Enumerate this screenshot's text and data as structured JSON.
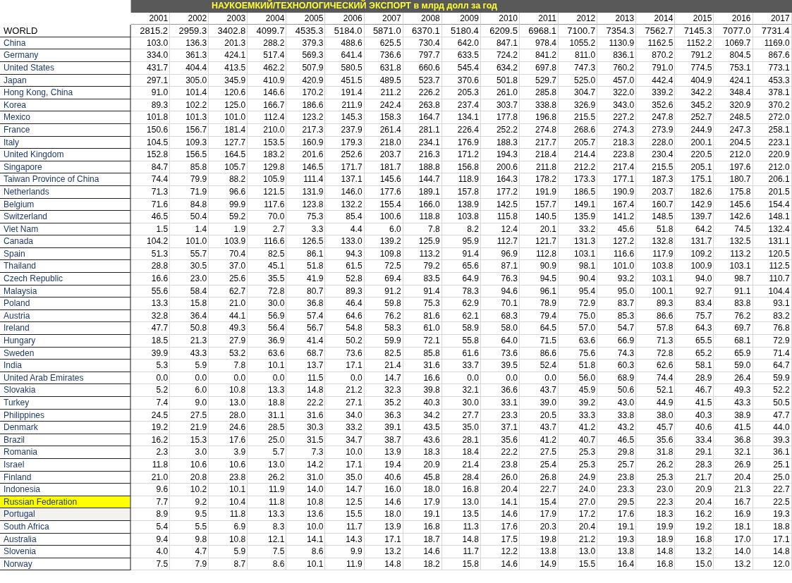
{
  "title": "НАУКОЕМКИЙ/ТЕХНОЛОГИЧЕСКИЙ ЭКСПОРТ в млрд долл за год",
  "years": [
    "2001",
    "2002",
    "2003",
    "2004",
    "2005",
    "2006",
    "2007",
    "2008",
    "2009",
    "2010",
    "2011",
    "2012",
    "2013",
    "2014",
    "2015",
    "2016",
    "2017"
  ],
  "rows": [
    {
      "name": "WORLD",
      "kind": "total",
      "highlighted": false,
      "selected": false,
      "values": [
        "2815.2",
        "2959.3",
        "3402.8",
        "4099.7",
        "4535.3",
        "5184.0",
        "5871.0",
        "6370.1",
        "5180.4",
        "6209.5",
        "6968.1",
        "7100.7",
        "7354.3",
        "7562.7",
        "7145.3",
        "7077.0",
        "7731.4"
      ]
    },
    {
      "name": "China",
      "kind": "country",
      "highlighted": false,
      "selected": false,
      "values": [
        "103.0",
        "136.3",
        "201.3",
        "288.2",
        "379.3",
        "488.6",
        "625.5",
        "730.4",
        "642.0",
        "847.1",
        "978.4",
        "1055.2",
        "1130.9",
        "1162.5",
        "1152.2",
        "1069.7",
        "1169.0"
      ]
    },
    {
      "name": "Germany",
      "kind": "country",
      "highlighted": false,
      "selected": false,
      "values": [
        "334.0",
        "361.3",
        "424.1",
        "517.4",
        "569.3",
        "641.4",
        "736.6",
        "797.7",
        "633.5",
        "724.2",
        "841.2",
        "811.0",
        "836.1",
        "870.2",
        "791.2",
        "804.5",
        "867.6"
      ]
    },
    {
      "name": "United States",
      "kind": "country",
      "highlighted": false,
      "selected": false,
      "values": [
        "431.7",
        "404.4",
        "413.5",
        "462.2",
        "507.9",
        "580.5",
        "631.8",
        "660.6",
        "545.4",
        "634.2",
        "697.8",
        "747.3",
        "760.2",
        "791.0",
        "774.5",
        "753.1",
        "773.1"
      ]
    },
    {
      "name": "Japan",
      "kind": "country",
      "highlighted": false,
      "selected": false,
      "values": [
        "297.1",
        "305.0",
        "345.9",
        "410.9",
        "420.9",
        "451.5",
        "489.5",
        "523.7",
        "370.6",
        "501.8",
        "529.7",
        "525.0",
        "457.0",
        "442.4",
        "404.9",
        "424.1",
        "453.3"
      ]
    },
    {
      "name": "Hong Kong, China",
      "kind": "country",
      "highlighted": false,
      "selected": false,
      "values": [
        "91.0",
        "101.4",
        "120.6",
        "146.6",
        "170.2",
        "191.4",
        "211.2",
        "226.2",
        "205.3",
        "261.0",
        "285.8",
        "304.7",
        "322.0",
        "339.2",
        "342.2",
        "348.4",
        "378.1"
      ]
    },
    {
      "name": "Korea",
      "kind": "country",
      "highlighted": false,
      "selected": false,
      "values": [
        "89.3",
        "102.2",
        "125.0",
        "166.7",
        "186.6",
        "211.9",
        "242.4",
        "263.8",
        "237.4",
        "303.7",
        "338.8",
        "326.9",
        "343.0",
        "352.6",
        "345.2",
        "320.9",
        "370.2"
      ]
    },
    {
      "name": "Mexico",
      "kind": "country",
      "highlighted": false,
      "selected": false,
      "values": [
        "101.8",
        "101.3",
        "101.0",
        "112.4",
        "123.2",
        "145.3",
        "158.3",
        "164.7",
        "134.1",
        "177.8",
        "196.8",
        "215.5",
        "227.2",
        "247.8",
        "252.7",
        "248.5",
        "272.0"
      ]
    },
    {
      "name": "France",
      "kind": "country",
      "highlighted": false,
      "selected": false,
      "values": [
        "150.6",
        "156.7",
        "181.4",
        "210.0",
        "217.3",
        "237.9",
        "261.4",
        "281.1",
        "226.4",
        "252.2",
        "274.8",
        "268.6",
        "274.3",
        "273.9",
        "244.9",
        "247.3",
        "258.1"
      ]
    },
    {
      "name": "Italy",
      "kind": "country",
      "highlighted": false,
      "selected": false,
      "values": [
        "104.5",
        "109.3",
        "127.7",
        "153.5",
        "160.9",
        "179.3",
        "218.0",
        "234.1",
        "176.9",
        "188.3",
        "217.7",
        "205.7",
        "218.3",
        "228.0",
        "200.1",
        "204.5",
        "223.1"
      ]
    },
    {
      "name": "United Kingdom",
      "kind": "country",
      "highlighted": false,
      "selected": false,
      "values": [
        "152.8",
        "156.5",
        "164.5",
        "183.2",
        "201.6",
        "252.6",
        "203.7",
        "216.3",
        "171.2",
        "194.3",
        "218.4",
        "214.4",
        "223.8",
        "230.4",
        "220.5",
        "212.0",
        "220.9"
      ]
    },
    {
      "name": "Singapore",
      "kind": "country",
      "highlighted": false,
      "selected": false,
      "values": [
        "84.7",
        "85.8",
        "105.7",
        "129.8",
        "146.5",
        "171.7",
        "181.7",
        "188.8",
        "156.8",
        "200.6",
        "211.8",
        "212.2",
        "217.4",
        "215.5",
        "205.1",
        "197.6",
        "212.0"
      ]
    },
    {
      "name": "Taiwan Province of China",
      "kind": "country",
      "highlighted": false,
      "selected": false,
      "values": [
        "74.4",
        "79.9",
        "88.2",
        "105.9",
        "111.4",
        "137.1",
        "145.6",
        "144.7",
        "118.9",
        "164.3",
        "178.2",
        "173.3",
        "177.1",
        "187.3",
        "175.1",
        "180.7",
        "206.1"
      ]
    },
    {
      "name": "Netherlands",
      "kind": "country",
      "highlighted": false,
      "selected": false,
      "values": [
        "71.3",
        "71.9",
        "96.6",
        "121.5",
        "131.9",
        "146.0",
        "177.6",
        "189.1",
        "157.8",
        "177.2",
        "191.9",
        "186.5",
        "190.9",
        "203.7",
        "182.6",
        "175.8",
        "201.5"
      ]
    },
    {
      "name": "Belgium",
      "kind": "country",
      "highlighted": false,
      "selected": false,
      "values": [
        "71.6",
        "84.8",
        "99.9",
        "117.6",
        "123.8",
        "132.2",
        "155.4",
        "166.0",
        "138.9",
        "142.5",
        "157.7",
        "149.1",
        "167.4",
        "160.7",
        "142.9",
        "145.6",
        "154.4"
      ]
    },
    {
      "name": "Switzerland",
      "kind": "country",
      "highlighted": false,
      "selected": false,
      "values": [
        "46.5",
        "50.4",
        "59.2",
        "70.0",
        "75.3",
        "85.4",
        "100.6",
        "118.8",
        "103.8",
        "115.8",
        "140.5",
        "135.9",
        "141.2",
        "148.5",
        "139.7",
        "142.6",
        "148.1"
      ]
    },
    {
      "name": "Viet Nam",
      "kind": "country",
      "highlighted": false,
      "selected": false,
      "values": [
        "1.5",
        "1.4",
        "1.9",
        "2.7",
        "3.3",
        "4.4",
        "6.0",
        "7.8",
        "8.2",
        "12.4",
        "20.1",
        "33.2",
        "45.6",
        "51.8",
        "64.2",
        "74.5",
        "132.4"
      ]
    },
    {
      "name": "Canada",
      "kind": "country",
      "highlighted": false,
      "selected": false,
      "values": [
        "104.2",
        "101.0",
        "103.9",
        "116.6",
        "126.5",
        "133.0",
        "139.2",
        "125.9",
        "95.9",
        "112.7",
        "121.7",
        "131.3",
        "127.2",
        "132.8",
        "131.7",
        "132.5",
        "131.1"
      ]
    },
    {
      "name": "Spain",
      "kind": "country",
      "highlighted": false,
      "selected": false,
      "values": [
        "51.3",
        "55.7",
        "70.4",
        "82.5",
        "86.1",
        "94.3",
        "109.8",
        "113.2",
        "91.4",
        "96.9",
        "112.8",
        "103.1",
        "116.6",
        "117.9",
        "109.2",
        "113.2",
        "120.5"
      ]
    },
    {
      "name": "Thailand",
      "kind": "country",
      "highlighted": false,
      "selected": false,
      "values": [
        "28.8",
        "30.5",
        "37.0",
        "45.1",
        "51.8",
        "61.5",
        "72.5",
        "79.2",
        "65.6",
        "87.1",
        "90.9",
        "98.1",
        "101.0",
        "103.8",
        "100.9",
        "103.1",
        "112.5"
      ]
    },
    {
      "name": "Czech Republic",
      "kind": "country",
      "highlighted": false,
      "selected": false,
      "values": [
        "16.6",
        "23.0",
        "25.6",
        "35.5",
        "41.9",
        "52.8",
        "69.4",
        "83.5",
        "64.9",
        "76.3",
        "94.5",
        "90.4",
        "93.2",
        "103.1",
        "94.0",
        "98.7",
        "110.7"
      ]
    },
    {
      "name": "Malaysia",
      "kind": "country",
      "highlighted": false,
      "selected": false,
      "values": [
        "55.6",
        "58.4",
        "62.7",
        "72.8",
        "80.7",
        "89.3",
        "91.2",
        "91.4",
        "78.3",
        "94.6",
        "96.1",
        "95.4",
        "95.0",
        "100.1",
        "92.7",
        "91.1",
        "104.4"
      ]
    },
    {
      "name": "Poland",
      "kind": "country",
      "highlighted": false,
      "selected": false,
      "values": [
        "13.3",
        "15.8",
        "21.0",
        "30.0",
        "36.8",
        "46.4",
        "59.8",
        "75.3",
        "62.9",
        "70.1",
        "78.9",
        "72.9",
        "83.7",
        "89.3",
        "83.4",
        "83.8",
        "93.1"
      ]
    },
    {
      "name": "Austria",
      "kind": "country",
      "highlighted": false,
      "selected": false,
      "values": [
        "32.8",
        "36.4",
        "44.1",
        "56.9",
        "57.4",
        "64.6",
        "76.2",
        "81.6",
        "62.1",
        "68.3",
        "79.4",
        "75.0",
        "85.3",
        "86.6",
        "75.7",
        "76.2",
        "83.2"
      ]
    },
    {
      "name": "Ireland",
      "kind": "country",
      "highlighted": false,
      "selected": false,
      "values": [
        "47.7",
        "50.8",
        "49.3",
        "56.4",
        "56.7",
        "54.8",
        "58.3",
        "61.0",
        "58.9",
        "58.0",
        "64.5",
        "57.0",
        "54.7",
        "57.8",
        "64.3",
        "69.7",
        "76.8"
      ]
    },
    {
      "name": "Hungary",
      "kind": "country",
      "highlighted": false,
      "selected": false,
      "values": [
        "18.5",
        "21.3",
        "27.9",
        "36.9",
        "41.4",
        "50.2",
        "59.9",
        "72.1",
        "55.8",
        "64.0",
        "71.5",
        "63.6",
        "66.9",
        "71.3",
        "65.5",
        "68.1",
        "72.9"
      ]
    },
    {
      "name": "Sweden",
      "kind": "country",
      "highlighted": false,
      "selected": false,
      "values": [
        "39.9",
        "43.3",
        "53.2",
        "63.6",
        "68.7",
        "73.6",
        "82.5",
        "85.8",
        "61.6",
        "73.6",
        "86.6",
        "75.6",
        "74.3",
        "72.8",
        "65.2",
        "65.9",
        "71.4"
      ]
    },
    {
      "name": "India",
      "kind": "country",
      "highlighted": false,
      "selected": false,
      "values": [
        "5.3",
        "5.9",
        "7.8",
        "10.1",
        "13.7",
        "17.1",
        "21.4",
        "31.6",
        "33.7",
        "39.5",
        "52.4",
        "51.8",
        "60.3",
        "62.6",
        "58.1",
        "59.0",
        "64.7"
      ]
    },
    {
      "name": "United Arab Emirates",
      "kind": "country",
      "highlighted": false,
      "selected": false,
      "values": [
        "0.0",
        "0.0",
        "0.0",
        "0.0",
        "11.5",
        "0.0",
        "14.7",
        "16.6",
        "0.0",
        "0.0",
        "0.0",
        "56.0",
        "68.9",
        "74.4",
        "28.9",
        "26.4",
        "59.9"
      ]
    },
    {
      "name": "Slovakia",
      "kind": "country",
      "highlighted": false,
      "selected": false,
      "values": [
        "5.2",
        "6.0",
        "10.8",
        "13.3",
        "14.8",
        "21.2",
        "32.3",
        "39.8",
        "32.1",
        "36.6",
        "43.7",
        "45.9",
        "50.6",
        "52.1",
        "46.7",
        "49.3",
        "52.2"
      ]
    },
    {
      "name": "Turkey",
      "kind": "country",
      "highlighted": false,
      "selected": false,
      "values": [
        "7.4",
        "9.0",
        "13.0",
        "18.8",
        "22.2",
        "27.1",
        "35.2",
        "40.3",
        "30.0",
        "33.1",
        "39.0",
        "39.2",
        "43.0",
        "44.9",
        "41.5",
        "43.3",
        "50.5"
      ]
    },
    {
      "name": "Philippines",
      "kind": "country",
      "highlighted": false,
      "selected": false,
      "values": [
        "24.5",
        "27.5",
        "28.0",
        "31.1",
        "31.6",
        "34.0",
        "36.3",
        "34.2",
        "27.7",
        "23.3",
        "20.5",
        "33.3",
        "33.8",
        "38.0",
        "40.3",
        "38.9",
        "47.7"
      ]
    },
    {
      "name": "Denmark",
      "kind": "country",
      "highlighted": false,
      "selected": false,
      "values": [
        "19.2",
        "21.9",
        "24.6",
        "28.5",
        "30.3",
        "33.2",
        "39.1",
        "43.5",
        "35.0",
        "37.1",
        "43.7",
        "41.2",
        "43.2",
        "45.7",
        "40.6",
        "41.5",
        "44.0"
      ]
    },
    {
      "name": "Brazil",
      "kind": "country",
      "highlighted": false,
      "selected": false,
      "values": [
        "16.2",
        "15.3",
        "17.6",
        "25.0",
        "31.5",
        "34.7",
        "38.7",
        "43.6",
        "28.1",
        "35.6",
        "41.2",
        "40.7",
        "46.5",
        "35.6",
        "33.4",
        "36.8",
        "39.3"
      ]
    },
    {
      "name": "Romania",
      "kind": "country",
      "highlighted": false,
      "selected": false,
      "values": [
        "2.3",
        "3.0",
        "3.9",
        "5.7",
        "7.3",
        "10.0",
        "13.9",
        "18.3",
        "18.4",
        "22.2",
        "27.5",
        "25.3",
        "29.8",
        "31.8",
        "29.1",
        "32.1",
        "36.1"
      ]
    },
    {
      "name": "Israel",
      "kind": "country",
      "highlighted": false,
      "selected": false,
      "values": [
        "11.8",
        "10.6",
        "10.6",
        "13.0",
        "14.2",
        "17.1",
        "19.4",
        "20.9",
        "21.4",
        "23.8",
        "25.4",
        "25.3",
        "25.7",
        "26.2",
        "28.3",
        "26.9",
        "25.1"
      ]
    },
    {
      "name": "Finland",
      "kind": "country",
      "highlighted": false,
      "selected": false,
      "values": [
        "21.0",
        "20.8",
        "23.8",
        "26.2",
        "31.0",
        "35.0",
        "40.6",
        "45.8",
        "28.4",
        "26.0",
        "26.8",
        "24.9",
        "23.8",
        "25.3",
        "21.7",
        "20.4",
        "25.0"
      ]
    },
    {
      "name": "Indonesia",
      "kind": "country",
      "highlighted": false,
      "selected": false,
      "values": [
        "9.6",
        "10.2",
        "10.1",
        "11.9",
        "14.0",
        "14.7",
        "16.0",
        "18.0",
        "16.8",
        "20.4",
        "22.7",
        "24.0",
        "23.3",
        "23.0",
        "20.9",
        "21.3",
        "22.7"
      ]
    },
    {
      "name": "Russian Federation",
      "kind": "country",
      "highlighted": true,
      "selected": false,
      "values": [
        "7.7",
        "9.2",
        "10.4",
        "11.8",
        "10.8",
        "12.5",
        "14.6",
        "17.9",
        "13.0",
        "14.1",
        "15.4",
        "27.0",
        "29.5",
        "22.3",
        "20.4",
        "16.7",
        "22.5"
      ]
    },
    {
      "name": "Portugal",
      "kind": "country",
      "highlighted": false,
      "selected": true,
      "values": [
        "8.9",
        "9.5",
        "11.8",
        "13.3",
        "13.6",
        "15.5",
        "18.0",
        "19.1",
        "13.5",
        "14.6",
        "17.9",
        "17.2",
        "17.6",
        "18.3",
        "16.2",
        "16.9",
        "19.3"
      ]
    },
    {
      "name": "South Africa",
      "kind": "country",
      "highlighted": false,
      "selected": false,
      "values": [
        "5.4",
        "5.5",
        "6.9",
        "8.3",
        "10.0",
        "11.7",
        "13.9",
        "16.8",
        "11.3",
        "17.6",
        "20.3",
        "20.4",
        "19.1",
        "19.9",
        "19.2",
        "18.1",
        "18.8"
      ]
    },
    {
      "name": "Australia",
      "kind": "country",
      "highlighted": false,
      "selected": false,
      "values": [
        "9.4",
        "9.8",
        "10.8",
        "12.1",
        "14.1",
        "14.3",
        "17.1",
        "18.7",
        "14.8",
        "17.5",
        "19.8",
        "21.2",
        "19.3",
        "18.9",
        "16.8",
        "17.0",
        "17.1"
      ]
    },
    {
      "name": "Slovenia",
      "kind": "country",
      "highlighted": false,
      "selected": false,
      "values": [
        "4.0",
        "4.7",
        "5.9",
        "7.5",
        "8.6",
        "9.9",
        "13.2",
        "14.6",
        "11.7",
        "12.2",
        "13.8",
        "13.0",
        "13.8",
        "14.8",
        "13.2",
        "14.0",
        "14.8"
      ]
    },
    {
      "name": "Norway",
      "kind": "country",
      "highlighted": false,
      "selected": false,
      "values": [
        "7.5",
        "7.9",
        "8.7",
        "8.6",
        "10.1",
        "11.9",
        "14.8",
        "18.2",
        "15.8",
        "14.6",
        "14.9",
        "15.5",
        "16.4",
        "16.8",
        "15.0",
        "13.2",
        "12.0"
      ]
    }
  ]
}
